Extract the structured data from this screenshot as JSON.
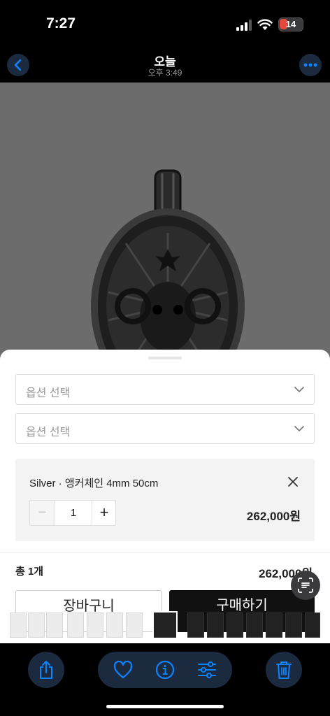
{
  "status_bar": {
    "time": "7:27",
    "battery": "14"
  },
  "nav": {
    "title": "오늘",
    "subtitle": "오후 3:49"
  },
  "sheet": {
    "option_select_1": "옵션 선택",
    "option_select_2": "옵션 선택",
    "selected_option": {
      "name": "Silver · 앵커체인 4mm 50cm",
      "quantity": "1",
      "minus": "−",
      "plus": "+",
      "price": "262,000원"
    },
    "total_label": "총 1개",
    "total_price": "262,000원",
    "cart_label": "장바구니",
    "buy_label": "구매하기"
  },
  "colors": {
    "accent": "#0a84ff",
    "toolbar_bg": "#1c2a3f",
    "battery_low": "#e5483f"
  },
  "icons": [
    "back-icon",
    "more-icon",
    "signal-icon",
    "wifi-icon",
    "battery-icon",
    "chevron-down-icon",
    "close-icon",
    "live-text-icon",
    "share-icon",
    "heart-icon",
    "info-icon",
    "sliders-icon",
    "trash-icon"
  ]
}
